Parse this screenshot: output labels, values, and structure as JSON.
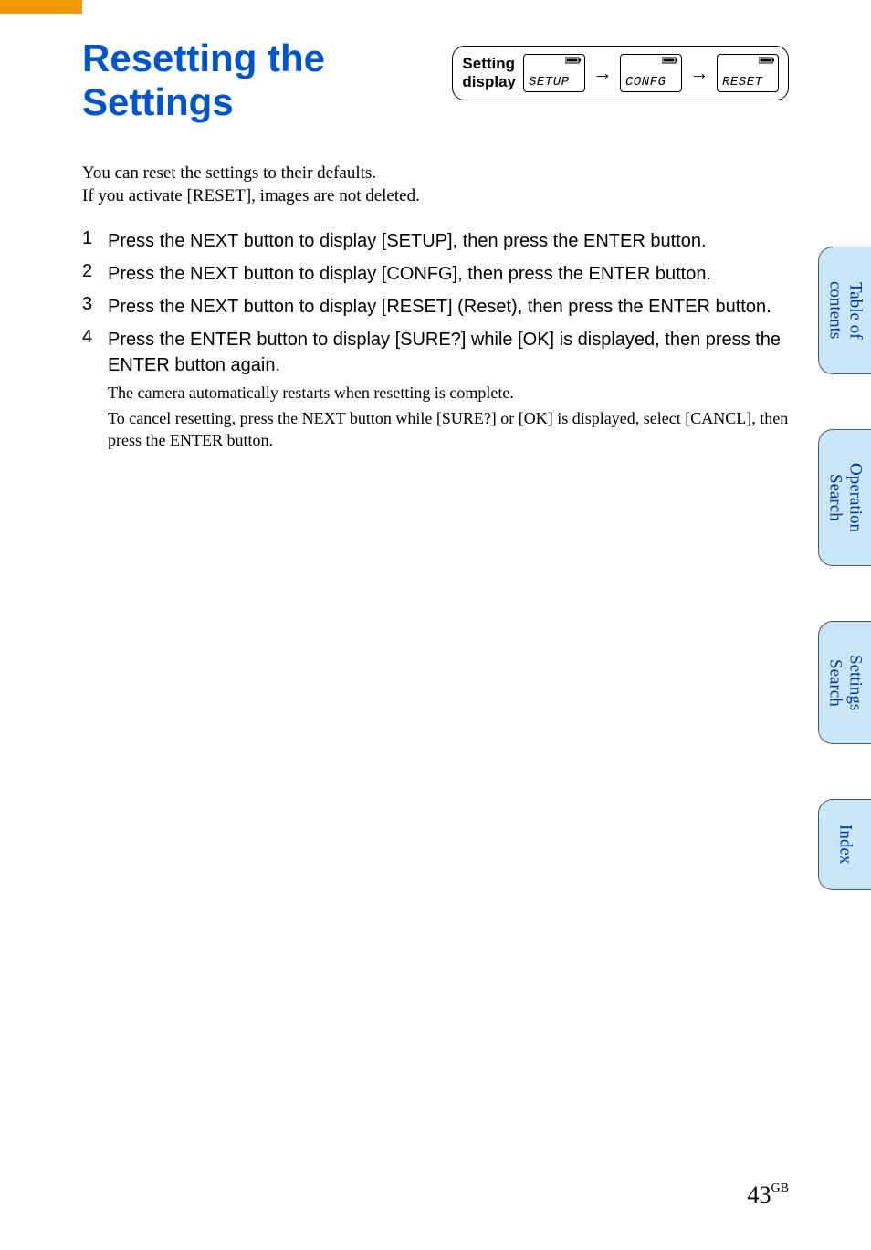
{
  "title": "Resetting the Settings",
  "setting_box": {
    "label": "Setting\ndisplay",
    "step1": "SETUP",
    "step2": "CONFG",
    "step3": "RESET"
  },
  "intro_line1": "You can reset the settings to their defaults.",
  "intro_line2": "If you activate [RESET], images are not deleted.",
  "steps": [
    {
      "main": "Press the NEXT button to display [SETUP], then press the ENTER button."
    },
    {
      "main": "Press the NEXT button to display [CONFG], then press the ENTER button."
    },
    {
      "main": "Press the NEXT button to display [RESET] (Reset), then press the ENTER button."
    },
    {
      "main": "Press the ENTER button to display [SURE?] while [OK] is displayed, then press the ENTER button again.",
      "note1": "The camera automatically restarts when resetting is complete.",
      "note2": "To cancel resetting, press the NEXT button while [SURE?] or [OK] is displayed, select [CANCL], then press the ENTER button."
    }
  ],
  "tabs": {
    "toc": "Table of\ncontents",
    "op": "Operation\nSearch",
    "set": "Settings\nSearch",
    "idx": "Index"
  },
  "page_number": "43",
  "page_suffix": "GB",
  "arrow": "→"
}
